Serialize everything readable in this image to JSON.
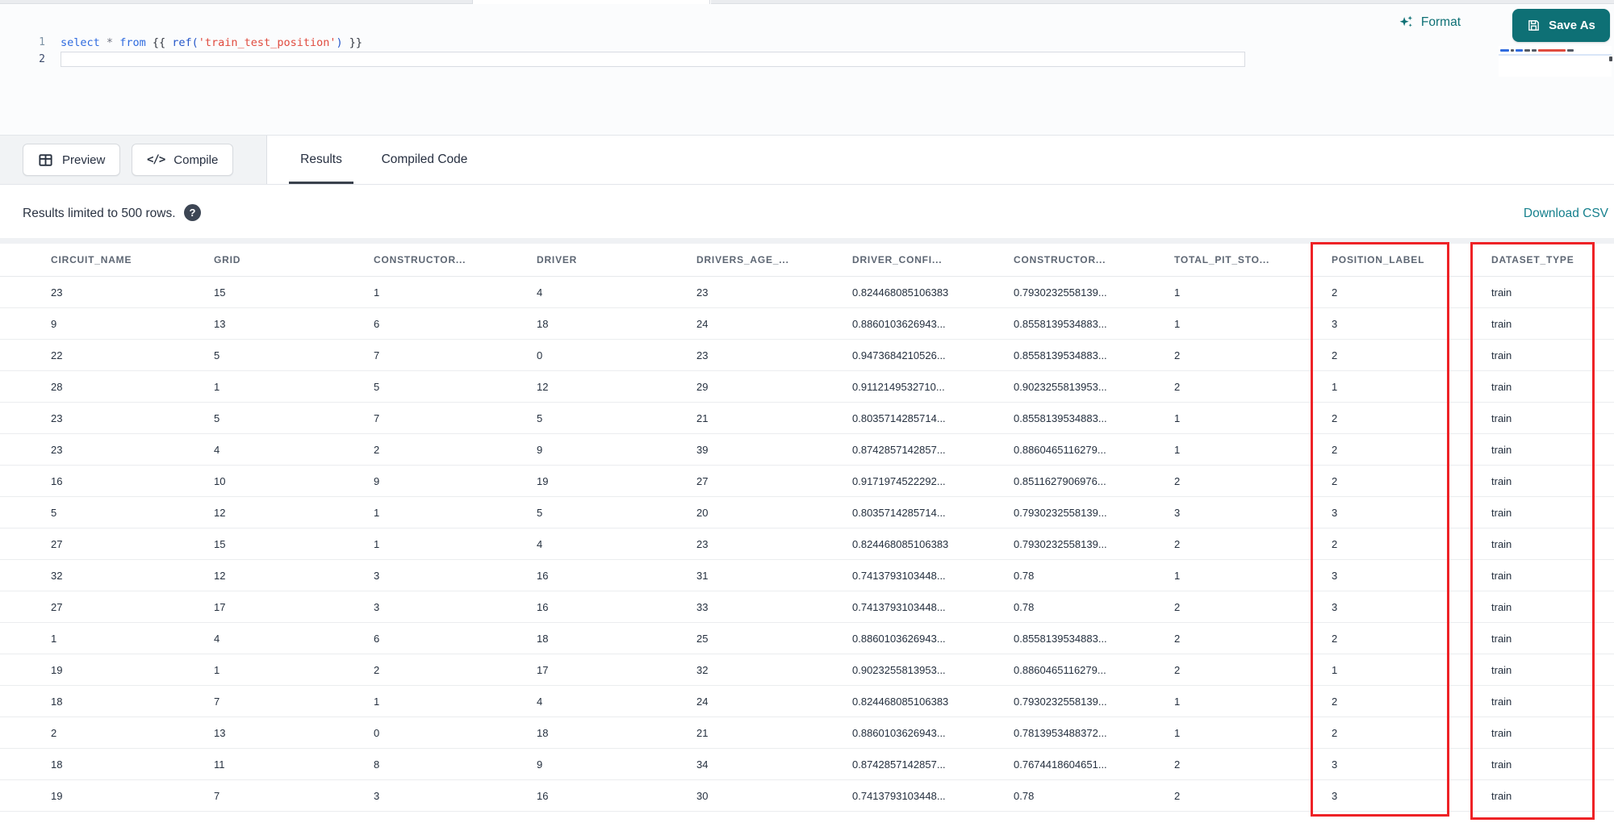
{
  "accent": {
    "teal": "#0e7075",
    "link_teal": "#16808d",
    "annotation_red": "#ee2226"
  },
  "editor": {
    "format_label": "Format",
    "save_as_label": "Save As",
    "code_lines": [
      {
        "number": "1",
        "tokens": [
          {
            "text": "select",
            "type": "keyword"
          },
          {
            "text": " ",
            "type": "plain"
          },
          {
            "text": "*",
            "type": "operator"
          },
          {
            "text": " ",
            "type": "plain"
          },
          {
            "text": "from",
            "type": "keyword"
          },
          {
            "text": " ",
            "type": "plain"
          },
          {
            "text": "{{",
            "type": "brace"
          },
          {
            "text": " ",
            "type": "plain"
          },
          {
            "text": "ref(",
            "type": "func"
          },
          {
            "text": "'train_test_position'",
            "type": "string"
          },
          {
            "text": ")",
            "type": "func"
          },
          {
            "text": " ",
            "type": "plain"
          },
          {
            "text": "}}",
            "type": "brace"
          }
        ]
      },
      {
        "number": "2",
        "tokens": []
      }
    ]
  },
  "toolbar": {
    "preview_label": "Preview",
    "compile_label": "Compile",
    "compile_glyph": "</>",
    "tabs": [
      {
        "label": "Results",
        "active": true
      },
      {
        "label": "Compiled Code",
        "active": false
      }
    ]
  },
  "results": {
    "limit_note": "Results limited to 500 rows.",
    "help_glyph": "?",
    "download_label": "Download CSV"
  },
  "table": {
    "columns": [
      "CIRCUIT_NAME",
      "GRID",
      "CONSTRUCTOR...",
      "DRIVER",
      "DRIVERS_AGE_...",
      "DRIVER_CONFI...",
      "CONSTRUCTOR...",
      "TOTAL_PIT_STO...",
      "POSITION_LABEL",
      "DATASET_TYPE"
    ],
    "highlighted_columns": [
      "POSITION_LABEL",
      "DATASET_TYPE"
    ],
    "rows": [
      [
        "23",
        "15",
        "1",
        "4",
        "23",
        "0.824468085106383",
        "0.7930232558139...",
        "1",
        "2",
        "train"
      ],
      [
        "9",
        "13",
        "6",
        "18",
        "24",
        "0.8860103626943...",
        "0.8558139534883...",
        "1",
        "3",
        "train"
      ],
      [
        "22",
        "5",
        "7",
        "0",
        "23",
        "0.9473684210526...",
        "0.8558139534883...",
        "2",
        "2",
        "train"
      ],
      [
        "28",
        "1",
        "5",
        "12",
        "29",
        "0.9112149532710...",
        "0.9023255813953...",
        "2",
        "1",
        "train"
      ],
      [
        "23",
        "5",
        "7",
        "5",
        "21",
        "0.8035714285714...",
        "0.8558139534883...",
        "1",
        "2",
        "train"
      ],
      [
        "23",
        "4",
        "2",
        "9",
        "39",
        "0.8742857142857...",
        "0.8860465116279...",
        "1",
        "2",
        "train"
      ],
      [
        "16",
        "10",
        "9",
        "19",
        "27",
        "0.9171974522292...",
        "0.8511627906976...",
        "2",
        "2",
        "train"
      ],
      [
        "5",
        "12",
        "1",
        "5",
        "20",
        "0.8035714285714...",
        "0.7930232558139...",
        "3",
        "3",
        "train"
      ],
      [
        "27",
        "15",
        "1",
        "4",
        "23",
        "0.824468085106383",
        "0.7930232558139...",
        "2",
        "2",
        "train"
      ],
      [
        "32",
        "12",
        "3",
        "16",
        "31",
        "0.7413793103448...",
        "0.78",
        "1",
        "3",
        "train"
      ],
      [
        "27",
        "17",
        "3",
        "16",
        "33",
        "0.7413793103448...",
        "0.78",
        "2",
        "3",
        "train"
      ],
      [
        "1",
        "4",
        "6",
        "18",
        "25",
        "0.8860103626943...",
        "0.8558139534883...",
        "2",
        "2",
        "train"
      ],
      [
        "19",
        "1",
        "2",
        "17",
        "32",
        "0.9023255813953...",
        "0.8860465116279...",
        "2",
        "1",
        "train"
      ],
      [
        "18",
        "7",
        "1",
        "4",
        "24",
        "0.824468085106383",
        "0.7930232558139...",
        "1",
        "2",
        "train"
      ],
      [
        "2",
        "13",
        "0",
        "18",
        "21",
        "0.8860103626943...",
        "0.7813953488372...",
        "1",
        "2",
        "train"
      ],
      [
        "18",
        "11",
        "8",
        "9",
        "34",
        "0.8742857142857...",
        "0.7674418604651...",
        "2",
        "3",
        "train"
      ],
      [
        "19",
        "7",
        "3",
        "16",
        "30",
        "0.7413793103448...",
        "0.78",
        "2",
        "3",
        "train"
      ]
    ]
  }
}
